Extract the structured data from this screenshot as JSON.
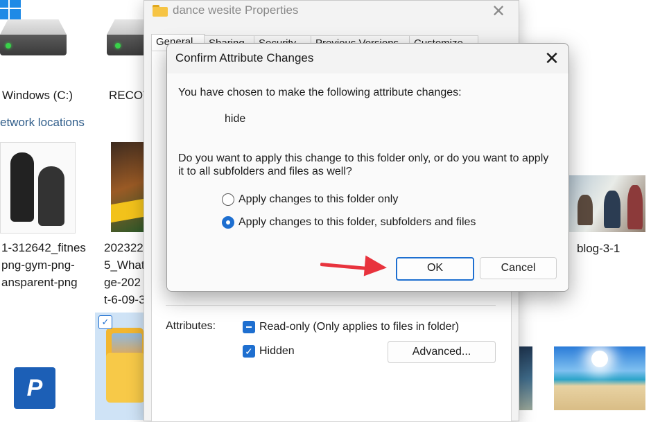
{
  "desktop": {
    "drive_c_label": "Windows (C:)",
    "drive_recovery_label": "RECOV",
    "network_locations_label": "etwork locations",
    "files": [
      {
        "line1": "1-312642_fitnes",
        "line2": "png-gym-png-",
        "line3": "ansparent-png"
      },
      {
        "line1": "202322",
        "line2": "5_What",
        "line3": "ge-202",
        "line4": "t-6-09-3"
      },
      {
        "line1": "blog-3-1"
      }
    ]
  },
  "properties_window": {
    "title": "dance wesite Properties",
    "tabs": [
      "General",
      "Sharing",
      "Security",
      "Previous Versions",
      "Customize"
    ],
    "attributes_label": "Attributes:",
    "readonly_label": "Read-only (Only applies to files in folder)",
    "hidden_label": "Hidden",
    "advanced_button": "Advanced...",
    "readonly_state": "indeterminate",
    "hidden_state": "checked"
  },
  "dialog": {
    "title": "Confirm Attribute Changes",
    "intro": "You have chosen to make the following attribute changes:",
    "change": "hide",
    "question_line1": "Do you want to apply this change to this folder only, or do you want to apply",
    "question_line2": "it to all subfolders and files as well?",
    "options": [
      {
        "label": "Apply changes to this folder only",
        "selected": false
      },
      {
        "label": "Apply changes to this folder, subfolders and files",
        "selected": true
      }
    ],
    "ok_label": "OK",
    "cancel_label": "Cancel"
  },
  "colors": {
    "accent": "#1e6fd0",
    "annotation_arrow": "#e8333d",
    "folder": "#f6c444"
  },
  "icons": [
    "windows-logo-icon",
    "folder-icon",
    "close-icon",
    "drive-icon",
    "checkbox-icon",
    "radio-icon",
    "arrow-annotation"
  ]
}
